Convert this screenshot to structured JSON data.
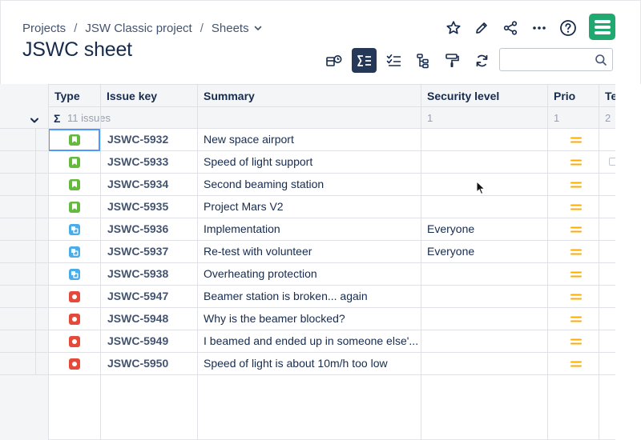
{
  "breadcrumb": {
    "items": [
      "Projects",
      "JSW Classic project",
      "Sheets"
    ],
    "separator": "/"
  },
  "page_title": "JSWC sheet",
  "header_icons": [
    "star-icon",
    "pencil-icon",
    "share-icon",
    "more-icon",
    "help-icon",
    "app-logo-icon"
  ],
  "toolbar": {
    "buttons": [
      "view-settings-icon",
      "sum-icon",
      "checklist-icon",
      "hierarchy-icon",
      "paint-roller-icon",
      "refresh-icon"
    ],
    "active": "sum-icon",
    "search": {
      "value": "",
      "placeholder": ""
    }
  },
  "columns": [
    "Type",
    "Issue key",
    "Summary",
    "Security level",
    "Prio",
    "Te"
  ],
  "group": {
    "label": "11 issues",
    "security_count": "1",
    "prio_count": "1",
    "te_count": "2"
  },
  "colors": {
    "story": "#63ba3c",
    "task": "#4bade8",
    "bug": "#e5493a",
    "priority_medium": "#ffab00",
    "accent": "#253858",
    "logo": "#1fa971",
    "selection": "#4c9aff"
  },
  "rows": [
    {
      "type": "story",
      "key": "JSWC-5932",
      "summary": "New space airport",
      "security": "",
      "priority": "medium"
    },
    {
      "type": "story",
      "key": "JSWC-5933",
      "summary": "Speed of light support",
      "security": "",
      "priority": "medium"
    },
    {
      "type": "story",
      "key": "JSWC-5934",
      "summary": "Second beaming station",
      "security": "",
      "priority": "medium"
    },
    {
      "type": "story",
      "key": "JSWC-5935",
      "summary": "Project Mars V2",
      "security": "",
      "priority": "medium"
    },
    {
      "type": "task",
      "key": "JSWC-5936",
      "summary": "Implementation",
      "security": "Everyone",
      "priority": "medium"
    },
    {
      "type": "task",
      "key": "JSWC-5937",
      "summary": "Re-test with volunteer",
      "security": "Everyone",
      "priority": "medium"
    },
    {
      "type": "task",
      "key": "JSWC-5938",
      "summary": "Overheating protection",
      "security": "",
      "priority": "medium"
    },
    {
      "type": "bug",
      "key": "JSWC-5947",
      "summary": "Beamer station is broken... again",
      "security": "",
      "priority": "medium"
    },
    {
      "type": "bug",
      "key": "JSWC-5948",
      "summary": "Why is the beamer blocked?",
      "security": "",
      "priority": "medium"
    },
    {
      "type": "bug",
      "key": "JSWC-5949",
      "summary": "I beamed and ended up in someone else'...",
      "security": "",
      "priority": "medium"
    },
    {
      "type": "bug",
      "key": "JSWC-5950",
      "summary": "Speed of light is about 10m/h too low",
      "security": "",
      "priority": "medium"
    }
  ]
}
